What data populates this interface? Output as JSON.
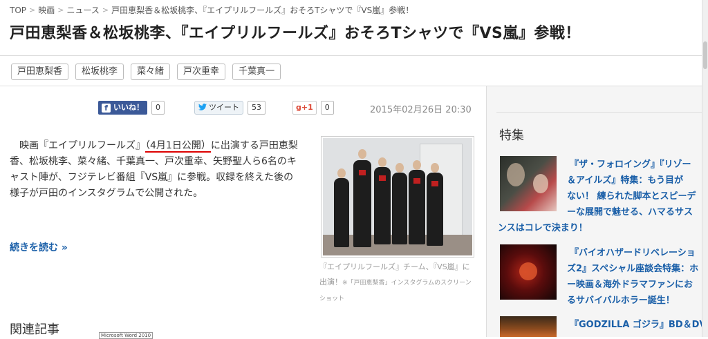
{
  "breadcrumb": {
    "items": [
      "TOP",
      "映画",
      "ニュース",
      "戸田恵梨香＆松坂桃李、『エイプリルフールズ』おそろTシャツで『VS嵐』参戦！"
    ],
    "separator": ">"
  },
  "article": {
    "title": "戸田恵梨香＆松坂桃李、『エイプリルフールズ』おそろTシャツで『VS嵐』参戦！",
    "tags": [
      "戸田恵梨香",
      "松坂桃李",
      "菜々緒",
      "戸次重幸",
      "千葉真一"
    ],
    "date": "2015年02月26日 20:30",
    "body_pre": "映画『エイプリルフールズ』",
    "body_highlight": "（4月1日公開）",
    "body_post": "に出演する戸田恵梨香、松坂桃李、菜々緒、千葉真一、戸次重幸、矢野聖人ら6名のキャスト陣が、フジテレビ番組『VS嵐』に参戦。収録を終えた後の様子が戸田のインスタグラムで公開された。",
    "read_more": "続きを読む »",
    "photo_caption": "『エイプリルフールズ』チーム、『VS嵐』に出演！",
    "photo_caption_small": "※「戸田恵梨香」インスタグラムのスクリーンショット"
  },
  "social": {
    "facebook_label": "いいね！",
    "facebook_icon": "f",
    "facebook_count": "0",
    "twitter_label": "ツイート",
    "twitter_count": "53",
    "gplus_label": "g+1",
    "gplus_count": "0"
  },
  "related": {
    "heading": "関連記事",
    "tooltip": "Microsoft Word 2010"
  },
  "sidebar": {
    "heading": "特集",
    "features": [
      {
        "title_lines": [
          "『ザ・フォロイング』『リゾー",
          "＆アイルズ』特集：もう目が",
          "ない！ 練られた脚本とスピーデ",
          "ーな展開で魅せる、ハマるサス",
          "ンスはコレで決まり！"
        ]
      },
      {
        "title_lines": [
          "『バイオハザードリベレーショ",
          "ズ2』スペシャル座談会特集：ホ",
          "ー映画＆海外ドラマファンにお",
          "るサバイバルホラー誕生！"
        ]
      },
      {
        "title_lines": [
          "『GODZILLA ゴジラ』BD＆DV"
        ]
      }
    ]
  },
  "colors": {
    "link": "#1a5fa8",
    "facebook": "#3b5998",
    "twitter": "#1da1f2",
    "gplus": "#dd4b39",
    "highlight_underline": "#dd0000"
  }
}
